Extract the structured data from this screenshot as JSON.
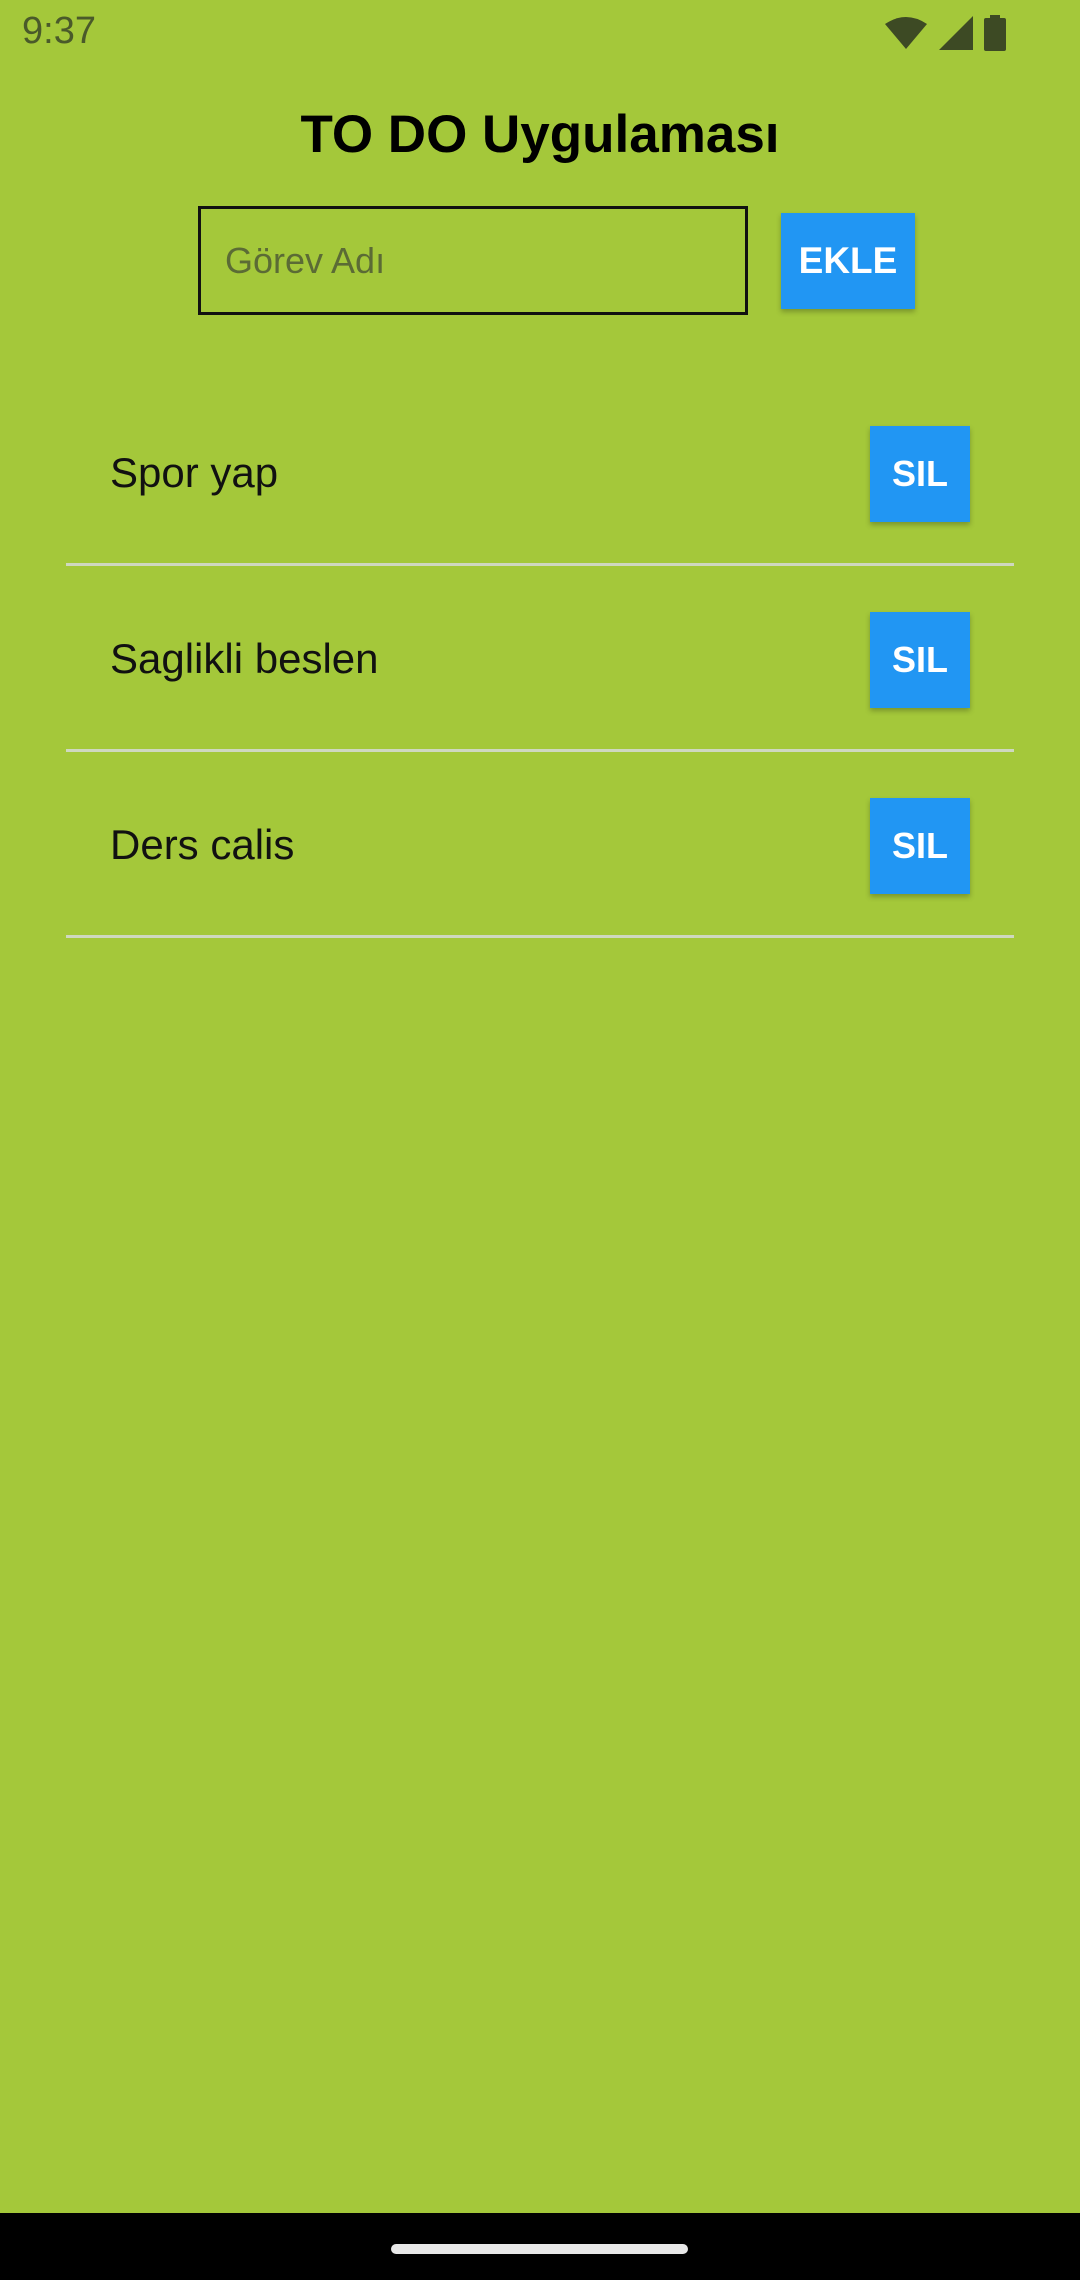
{
  "status_bar": {
    "time": "9:37",
    "icons": [
      "wifi-icon",
      "cellular-signal-icon",
      "battery-icon"
    ],
    "text_color": "#4a5a2a"
  },
  "app": {
    "title": "TO DO Uygulaması",
    "background_color": "#a4c83a",
    "accent_color": "#2196f3"
  },
  "input": {
    "placeholder": "Görev Adı",
    "value": ""
  },
  "add_button": {
    "label": "EKLE"
  },
  "tasks": [
    {
      "text": "Spor yap",
      "delete_label": "SIL"
    },
    {
      "text": "Saglikli beslen",
      "delete_label": "SIL"
    },
    {
      "text": "Ders calis",
      "delete_label": "SIL"
    }
  ]
}
